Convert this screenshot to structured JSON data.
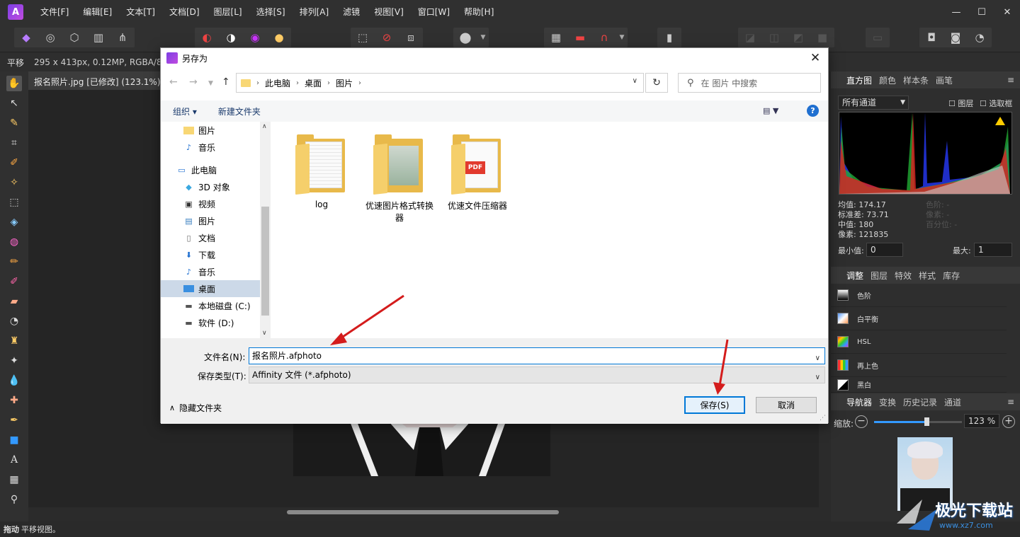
{
  "menubar": {
    "items": [
      "文件[F]",
      "编辑[E]",
      "文本[T]",
      "文档[D]",
      "图层[L]",
      "选择[S]",
      "排列[A]",
      "滤镜",
      "视图[V]",
      "窗口[W]",
      "帮助[H]"
    ],
    "logo_icon": "affinity-photo-logo",
    "window_controls": [
      "minimize-icon",
      "maximize-icon",
      "close-icon"
    ]
  },
  "context": {
    "tool": "平移",
    "info": "295 x 413px, 0.12MP, RGBA/8"
  },
  "document": {
    "tab_title": "报名照片.jpg [已修改] (123.1%)"
  },
  "histogram_panel": {
    "tabs": [
      "直方图",
      "颜色",
      "样本条",
      "画笔"
    ],
    "channel": "所有通道",
    "chk_layer": "图层",
    "chk_selection": "选取框",
    "stats_left": [
      "均值: 174.17",
      "标准差: 73.71",
      "中值: 180",
      "像素: 121835"
    ],
    "stats_right": [
      "色阶: -",
      "像素: -",
      "百分位: -"
    ],
    "min_label": "最小值:",
    "min_value": "0",
    "max_label": "最大:",
    "max_value": "1"
  },
  "adjust_panel": {
    "tabs": [
      "调整",
      "图层",
      "特效",
      "样式",
      "库存"
    ],
    "items": [
      "色阶",
      "白平衡",
      "HSL",
      "再上色",
      "黑白"
    ]
  },
  "navigator_panel": {
    "tabs": [
      "导航器",
      "变换",
      "历史记录",
      "通道"
    ],
    "zoom_label": "缩放:",
    "zoom_value": "123 %",
    "zoom_level": 0.6
  },
  "status": {
    "bold": "拖动",
    "text": "平移视图。"
  },
  "dialog": {
    "title": "另存为",
    "breadcrumb": [
      "此电脑",
      "桌面",
      "图片"
    ],
    "search_placeholder": "在 图片 中搜索",
    "organize": "组织 ▾",
    "new_folder": "新建文件夹",
    "nav_items": [
      {
        "label": "图片",
        "icon": "folder-icon"
      },
      {
        "label": "音乐",
        "icon": "music-icon"
      },
      {
        "label": "此电脑",
        "icon": "computer-icon"
      },
      {
        "label": "3D 对象",
        "icon": "cube-icon"
      },
      {
        "label": "视频",
        "icon": "video-icon"
      },
      {
        "label": "图片",
        "icon": "pictures-icon"
      },
      {
        "label": "文档",
        "icon": "document-icon"
      },
      {
        "label": "下载",
        "icon": "download-icon"
      },
      {
        "label": "音乐",
        "icon": "music-icon"
      },
      {
        "label": "桌面",
        "icon": "desktop-icon"
      },
      {
        "label": "本地磁盘 (C:)",
        "icon": "drive-icon"
      },
      {
        "label": "软件 (D:)",
        "icon": "drive-icon"
      }
    ],
    "files": [
      "log",
      "优速图片格式转换器",
      "优速文件压缩器"
    ],
    "filename_label": "文件名(N):",
    "filename_value": "报名照片.afphoto",
    "filetype_label": "保存类型(T):",
    "filetype_value": "Affinity 文件 (*.afphoto)",
    "hide_folders": "隐藏文件夹",
    "save": "保存(S)",
    "cancel": "取消"
  },
  "watermark": {
    "text": "极光下载站",
    "url": "www.xz7.com"
  },
  "colors": {
    "accent": "#0078d7",
    "app_bg": "#2b2b2b",
    "annotation_arrow": "#d41c1c"
  }
}
